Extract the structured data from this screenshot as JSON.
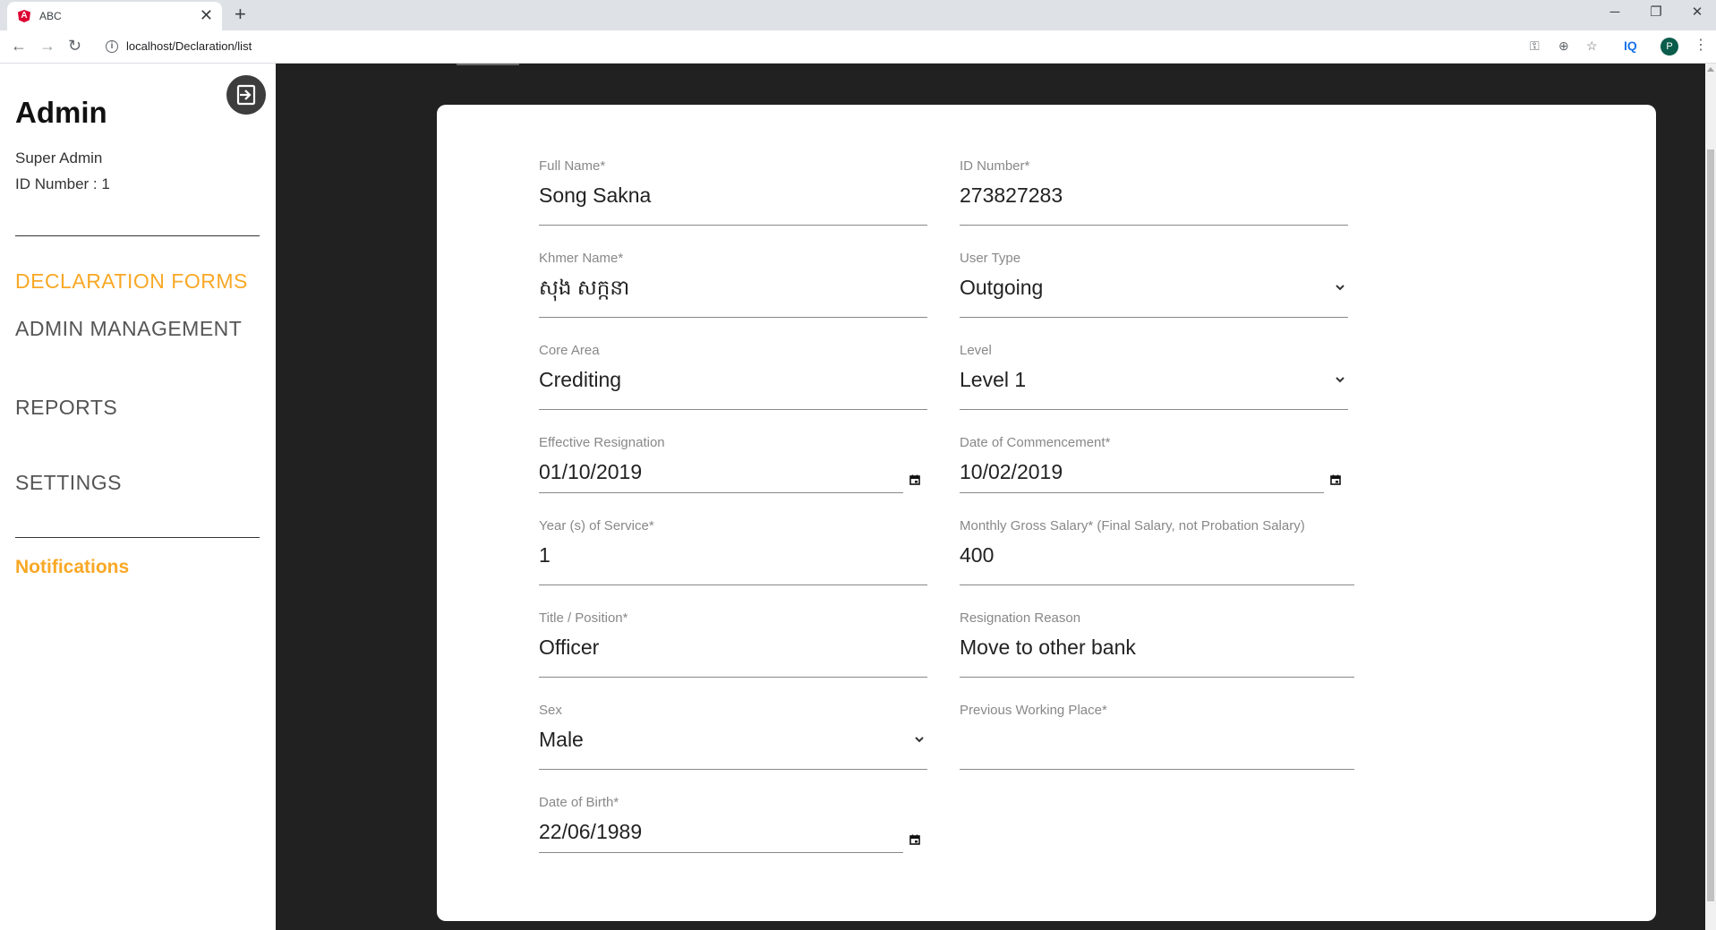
{
  "browser": {
    "tab_title": "ABC",
    "tab_close": "✕",
    "new_tab": "+",
    "url": "localhost/Declaration/list",
    "profile_initial": "P",
    "extension_label": "IQ"
  },
  "sidebar": {
    "title": "Admin",
    "role": "Super Admin",
    "id_label": "ID Number : 1",
    "nav": [
      "DECLARATION FORMS",
      "ADMIN MANAGEMENT",
      "REPORTS",
      "SETTINGS"
    ],
    "notifications": "Notifications",
    "accent_color": "#f9a825"
  },
  "form": {
    "full_name": {
      "label": "Full Name*",
      "value": "Song Sakna"
    },
    "id_number": {
      "label": "ID Number*",
      "value": "273827283"
    },
    "khmer_name": {
      "label": "Khmer Name*",
      "value": "សុង សក្កនា"
    },
    "user_type": {
      "label": "User Type",
      "value": "Outgoing"
    },
    "core_area": {
      "label": "Core Area",
      "value": "Crediting"
    },
    "level": {
      "label": "Level",
      "value": "Level 1"
    },
    "effective_resignation": {
      "label": "Effective Resignation",
      "value": "01/10/2019"
    },
    "date_of_commencement": {
      "label": "Date of Commencement*",
      "value": "10/02/2019"
    },
    "years_of_service": {
      "label": "Year (s) of Service*",
      "value": "1"
    },
    "monthly_gross_salary": {
      "label": "Monthly Gross Salary* (Final Salary, not Probation Salary)",
      "value": "400"
    },
    "title_position": {
      "label": "Title / Position*",
      "value": "Officer"
    },
    "resignation_reason": {
      "label": "Resignation Reason",
      "value": "Move to other bank"
    },
    "sex": {
      "label": "Sex",
      "value": "Male"
    },
    "previous_working_place": {
      "label": "Previous Working Place*",
      "value": ""
    },
    "date_of_birth": {
      "label": "Date of Birth*",
      "value": "22/06/1989"
    }
  }
}
